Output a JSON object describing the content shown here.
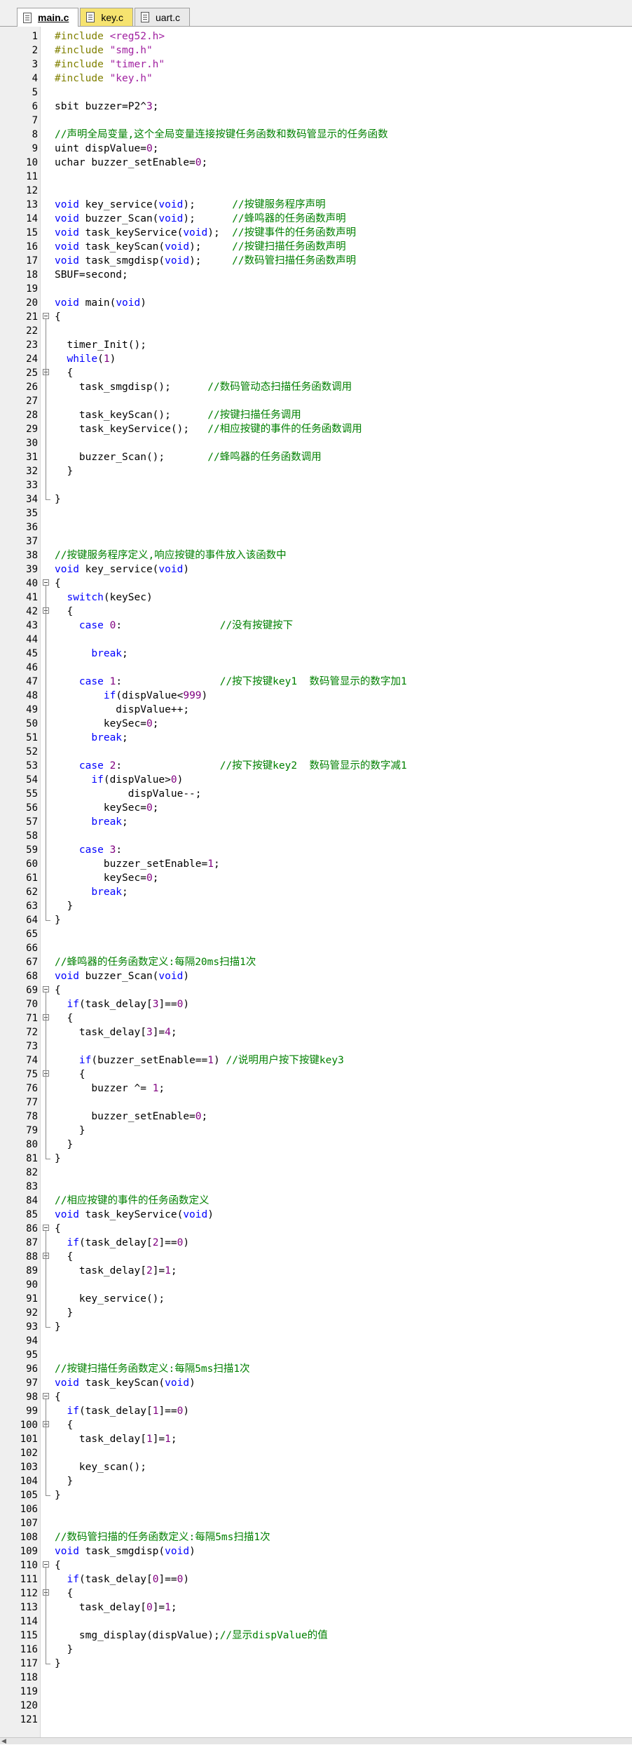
{
  "tabs": [
    {
      "label": "main.c",
      "icon": "file-icon",
      "active": true
    },
    {
      "label": "key.c",
      "icon": "file-icon",
      "active": false
    },
    {
      "label": "uart.c",
      "icon": "file-icon",
      "active": false
    }
  ],
  "colors": {
    "keyword": "#0000ff",
    "number": "#800080",
    "comment": "#008000",
    "preprocessor": "#808000",
    "string": "#a020a0"
  },
  "fold_lines": [
    21,
    25,
    40,
    42,
    69,
    71,
    75,
    86,
    88,
    98,
    100,
    110,
    112
  ],
  "lines": [
    [
      [
        "pp",
        "#include "
      ],
      [
        "str",
        "<reg52.h>"
      ]
    ],
    [
      [
        "pp",
        "#include "
      ],
      [
        "str",
        "\"smg.h\""
      ]
    ],
    [
      [
        "pp",
        "#include "
      ],
      [
        "str",
        "\"timer.h\""
      ]
    ],
    [
      [
        "pp",
        "#include "
      ],
      [
        "str",
        "\"key.h\""
      ]
    ],
    [],
    [
      [
        "t",
        "sbit buzzer=P2^"
      ],
      [
        "num",
        "3"
      ],
      [
        "t",
        ";"
      ]
    ],
    [],
    [
      [
        "cm",
        "//声明全局变量,这个全局变量连接按键任务函数和数码管显示的任务函数"
      ]
    ],
    [
      [
        "t",
        "uint dispValue="
      ],
      [
        "num",
        "0"
      ],
      [
        "t",
        ";"
      ]
    ],
    [
      [
        "t",
        "uchar buzzer_setEnable="
      ],
      [
        "num",
        "0"
      ],
      [
        "t",
        ";"
      ]
    ],
    [],
    [],
    [
      [
        "kw",
        "void"
      ],
      [
        "t",
        " key_service("
      ],
      [
        "kw",
        "void"
      ],
      [
        "t",
        ");      "
      ],
      [
        "cm",
        "//按键服务程序声明"
      ]
    ],
    [
      [
        "kw",
        "void"
      ],
      [
        "t",
        " buzzer_Scan("
      ],
      [
        "kw",
        "void"
      ],
      [
        "t",
        ");      "
      ],
      [
        "cm",
        "//蜂鸣器的任务函数声明"
      ]
    ],
    [
      [
        "kw",
        "void"
      ],
      [
        "t",
        " task_keyService("
      ],
      [
        "kw",
        "void"
      ],
      [
        "t",
        ");  "
      ],
      [
        "cm",
        "//按键事件的任务函数声明"
      ]
    ],
    [
      [
        "kw",
        "void"
      ],
      [
        "t",
        " task_keyScan("
      ],
      [
        "kw",
        "void"
      ],
      [
        "t",
        ");     "
      ],
      [
        "cm",
        "//按键扫描任务函数声明"
      ]
    ],
    [
      [
        "kw",
        "void"
      ],
      [
        "t",
        " task_smgdisp("
      ],
      [
        "kw",
        "void"
      ],
      [
        "t",
        ");     "
      ],
      [
        "cm",
        "//数码管扫描任务函数声明"
      ]
    ],
    [
      [
        "t",
        "SBUF=second;"
      ]
    ],
    [],
    [
      [
        "kw",
        "void"
      ],
      [
        "t",
        " main("
      ],
      [
        "kw",
        "void"
      ],
      [
        "t",
        ")"
      ]
    ],
    [
      [
        "t",
        "{"
      ]
    ],
    [],
    [
      [
        "t",
        "  timer_Init();"
      ]
    ],
    [
      [
        "t",
        "  "
      ],
      [
        "kw",
        "while"
      ],
      [
        "t",
        "("
      ],
      [
        "num",
        "1"
      ],
      [
        "t",
        ")"
      ]
    ],
    [
      [
        "t",
        "  {"
      ]
    ],
    [
      [
        "t",
        "    task_smgdisp();      "
      ],
      [
        "cm",
        "//数码管动态扫描任务函数调用"
      ]
    ],
    [],
    [
      [
        "t",
        "    task_keyScan();      "
      ],
      [
        "cm",
        "//按键扫描任务调用"
      ]
    ],
    [
      [
        "t",
        "    task_keyService();   "
      ],
      [
        "cm",
        "//相应按键的事件的任务函数调用"
      ]
    ],
    [],
    [
      [
        "t",
        "    buzzer_Scan();       "
      ],
      [
        "cm",
        "//蜂鸣器的任务函数调用"
      ]
    ],
    [
      [
        "t",
        "  }"
      ]
    ],
    [],
    [
      [
        "t",
        "}"
      ]
    ],
    [],
    [],
    [],
    [
      [
        "cm",
        "//按键服务程序定义,响应按键的事件放入该函数中"
      ]
    ],
    [
      [
        "kw",
        "void"
      ],
      [
        "t",
        " key_service("
      ],
      [
        "kw",
        "void"
      ],
      [
        "t",
        ")"
      ]
    ],
    [
      [
        "t",
        "{"
      ]
    ],
    [
      [
        "t",
        "  "
      ],
      [
        "kw",
        "switch"
      ],
      [
        "t",
        "(keySec)"
      ]
    ],
    [
      [
        "t",
        "  {"
      ]
    ],
    [
      [
        "t",
        "    "
      ],
      [
        "kw",
        "case"
      ],
      [
        "t",
        " "
      ],
      [
        "num",
        "0"
      ],
      [
        "t",
        ":                "
      ],
      [
        "cm",
        "//没有按键按下"
      ]
    ],
    [],
    [
      [
        "t",
        "      "
      ],
      [
        "kw",
        "break"
      ],
      [
        "t",
        ";"
      ]
    ],
    [],
    [
      [
        "t",
        "    "
      ],
      [
        "kw",
        "case"
      ],
      [
        "t",
        " "
      ],
      [
        "num",
        "1"
      ],
      [
        "t",
        ":                "
      ],
      [
        "cm",
        "//按下按键key1  数码管显示的数字加1"
      ]
    ],
    [
      [
        "t",
        "        "
      ],
      [
        "kw",
        "if"
      ],
      [
        "t",
        "(dispValue<"
      ],
      [
        "num",
        "999"
      ],
      [
        "t",
        ")"
      ]
    ],
    [
      [
        "t",
        "          dispValue++;"
      ]
    ],
    [
      [
        "t",
        "        keySec="
      ],
      [
        "num",
        "0"
      ],
      [
        "t",
        ";"
      ]
    ],
    [
      [
        "t",
        "      "
      ],
      [
        "kw",
        "break"
      ],
      [
        "t",
        ";"
      ]
    ],
    [],
    [
      [
        "t",
        "    "
      ],
      [
        "kw",
        "case"
      ],
      [
        "t",
        " "
      ],
      [
        "num",
        "2"
      ],
      [
        "t",
        ":                "
      ],
      [
        "cm",
        "//按下按键key2  数码管显示的数字减1"
      ]
    ],
    [
      [
        "t",
        "      "
      ],
      [
        "kw",
        "if"
      ],
      [
        "t",
        "(dispValue>"
      ],
      [
        "num",
        "0"
      ],
      [
        "t",
        ")"
      ]
    ],
    [
      [
        "t",
        "            dispValue--;"
      ]
    ],
    [
      [
        "t",
        "        keySec="
      ],
      [
        "num",
        "0"
      ],
      [
        "t",
        ";"
      ]
    ],
    [
      [
        "t",
        "      "
      ],
      [
        "kw",
        "break"
      ],
      [
        "t",
        ";"
      ]
    ],
    [],
    [
      [
        "t",
        "    "
      ],
      [
        "kw",
        "case"
      ],
      [
        "t",
        " "
      ],
      [
        "num",
        "3"
      ],
      [
        "t",
        ":"
      ]
    ],
    [
      [
        "t",
        "        buzzer_setEnable="
      ],
      [
        "num",
        "1"
      ],
      [
        "t",
        ";"
      ]
    ],
    [
      [
        "t",
        "        keySec="
      ],
      [
        "num",
        "0"
      ],
      [
        "t",
        ";"
      ]
    ],
    [
      [
        "t",
        "      "
      ],
      [
        "kw",
        "break"
      ],
      [
        "t",
        ";"
      ]
    ],
    [
      [
        "t",
        "  }"
      ]
    ],
    [
      [
        "t",
        "}"
      ]
    ],
    [],
    [],
    [
      [
        "cm",
        "//蜂鸣器的任务函数定义:每隔20ms扫描1次"
      ]
    ],
    [
      [
        "kw",
        "void"
      ],
      [
        "t",
        " buzzer_Scan("
      ],
      [
        "kw",
        "void"
      ],
      [
        "t",
        ")"
      ]
    ],
    [
      [
        "t",
        "{"
      ]
    ],
    [
      [
        "t",
        "  "
      ],
      [
        "kw",
        "if"
      ],
      [
        "t",
        "(task_delay["
      ],
      [
        "num",
        "3"
      ],
      [
        "t",
        "]=="
      ],
      [
        "num",
        "0"
      ],
      [
        "t",
        ")"
      ]
    ],
    [
      [
        "t",
        "  {"
      ]
    ],
    [
      [
        "t",
        "    task_delay["
      ],
      [
        "num",
        "3"
      ],
      [
        "t",
        "]="
      ],
      [
        "num",
        "4"
      ],
      [
        "t",
        ";"
      ]
    ],
    [],
    [
      [
        "t",
        "    "
      ],
      [
        "kw",
        "if"
      ],
      [
        "t",
        "(buzzer_setEnable=="
      ],
      [
        "num",
        "1"
      ],
      [
        "t",
        ") "
      ],
      [
        "cm",
        "//说明用户按下按键key3"
      ]
    ],
    [
      [
        "t",
        "    {"
      ]
    ],
    [
      [
        "t",
        "      buzzer ^= "
      ],
      [
        "num",
        "1"
      ],
      [
        "t",
        ";"
      ]
    ],
    [],
    [
      [
        "t",
        "      buzzer_setEnable="
      ],
      [
        "num",
        "0"
      ],
      [
        "t",
        ";"
      ]
    ],
    [
      [
        "t",
        "    }"
      ]
    ],
    [
      [
        "t",
        "  }"
      ]
    ],
    [
      [
        "t",
        "}"
      ]
    ],
    [],
    [],
    [
      [
        "cm",
        "//相应按键的事件的任务函数定义"
      ]
    ],
    [
      [
        "kw",
        "void"
      ],
      [
        "t",
        " task_keyService("
      ],
      [
        "kw",
        "void"
      ],
      [
        "t",
        ")"
      ]
    ],
    [
      [
        "t",
        "{"
      ]
    ],
    [
      [
        "t",
        "  "
      ],
      [
        "kw",
        "if"
      ],
      [
        "t",
        "(task_delay["
      ],
      [
        "num",
        "2"
      ],
      [
        "t",
        "]=="
      ],
      [
        "num",
        "0"
      ],
      [
        "t",
        ")"
      ]
    ],
    [
      [
        "t",
        "  {"
      ]
    ],
    [
      [
        "t",
        "    task_delay["
      ],
      [
        "num",
        "2"
      ],
      [
        "t",
        "]="
      ],
      [
        "num",
        "1"
      ],
      [
        "t",
        ";"
      ]
    ],
    [],
    [
      [
        "t",
        "    key_service();"
      ]
    ],
    [
      [
        "t",
        "  }"
      ]
    ],
    [
      [
        "t",
        "}"
      ]
    ],
    [],
    [],
    [
      [
        "cm",
        "//按键扫描任务函数定义:每隔5ms扫描1次"
      ]
    ],
    [
      [
        "kw",
        "void"
      ],
      [
        "t",
        " task_keyScan("
      ],
      [
        "kw",
        "void"
      ],
      [
        "t",
        ")"
      ]
    ],
    [
      [
        "t",
        "{"
      ]
    ],
    [
      [
        "t",
        "  "
      ],
      [
        "kw",
        "if"
      ],
      [
        "t",
        "(task_delay["
      ],
      [
        "num",
        "1"
      ],
      [
        "t",
        "]=="
      ],
      [
        "num",
        "0"
      ],
      [
        "t",
        ")"
      ]
    ],
    [
      [
        "t",
        "  {"
      ]
    ],
    [
      [
        "t",
        "    task_delay["
      ],
      [
        "num",
        "1"
      ],
      [
        "t",
        "]="
      ],
      [
        "num",
        "1"
      ],
      [
        "t",
        ";"
      ]
    ],
    [],
    [
      [
        "t",
        "    key_scan();"
      ]
    ],
    [
      [
        "t",
        "  }"
      ]
    ],
    [
      [
        "t",
        "}"
      ]
    ],
    [],
    [],
    [
      [
        "cm",
        "//数码管扫描的任务函数定义:每隔5ms扫描1次"
      ]
    ],
    [
      [
        "kw",
        "void"
      ],
      [
        "t",
        " task_smgdisp("
      ],
      [
        "kw",
        "void"
      ],
      [
        "t",
        ")"
      ]
    ],
    [
      [
        "t",
        "{"
      ]
    ],
    [
      [
        "t",
        "  "
      ],
      [
        "kw",
        "if"
      ],
      [
        "t",
        "(task_delay["
      ],
      [
        "num",
        "0"
      ],
      [
        "t",
        "]=="
      ],
      [
        "num",
        "0"
      ],
      [
        "t",
        ")"
      ]
    ],
    [
      [
        "t",
        "  {"
      ]
    ],
    [
      [
        "t",
        "    task_delay["
      ],
      [
        "num",
        "0"
      ],
      [
        "t",
        "]="
      ],
      [
        "num",
        "1"
      ],
      [
        "t",
        ";"
      ]
    ],
    [],
    [
      [
        "t",
        "    smg_display(dispValue);"
      ],
      [
        "cm",
        "//显示dispValue的值"
      ]
    ],
    [
      [
        "t",
        "  }"
      ]
    ],
    [
      [
        "t",
        "}"
      ]
    ],
    [],
    [],
    [],
    []
  ]
}
